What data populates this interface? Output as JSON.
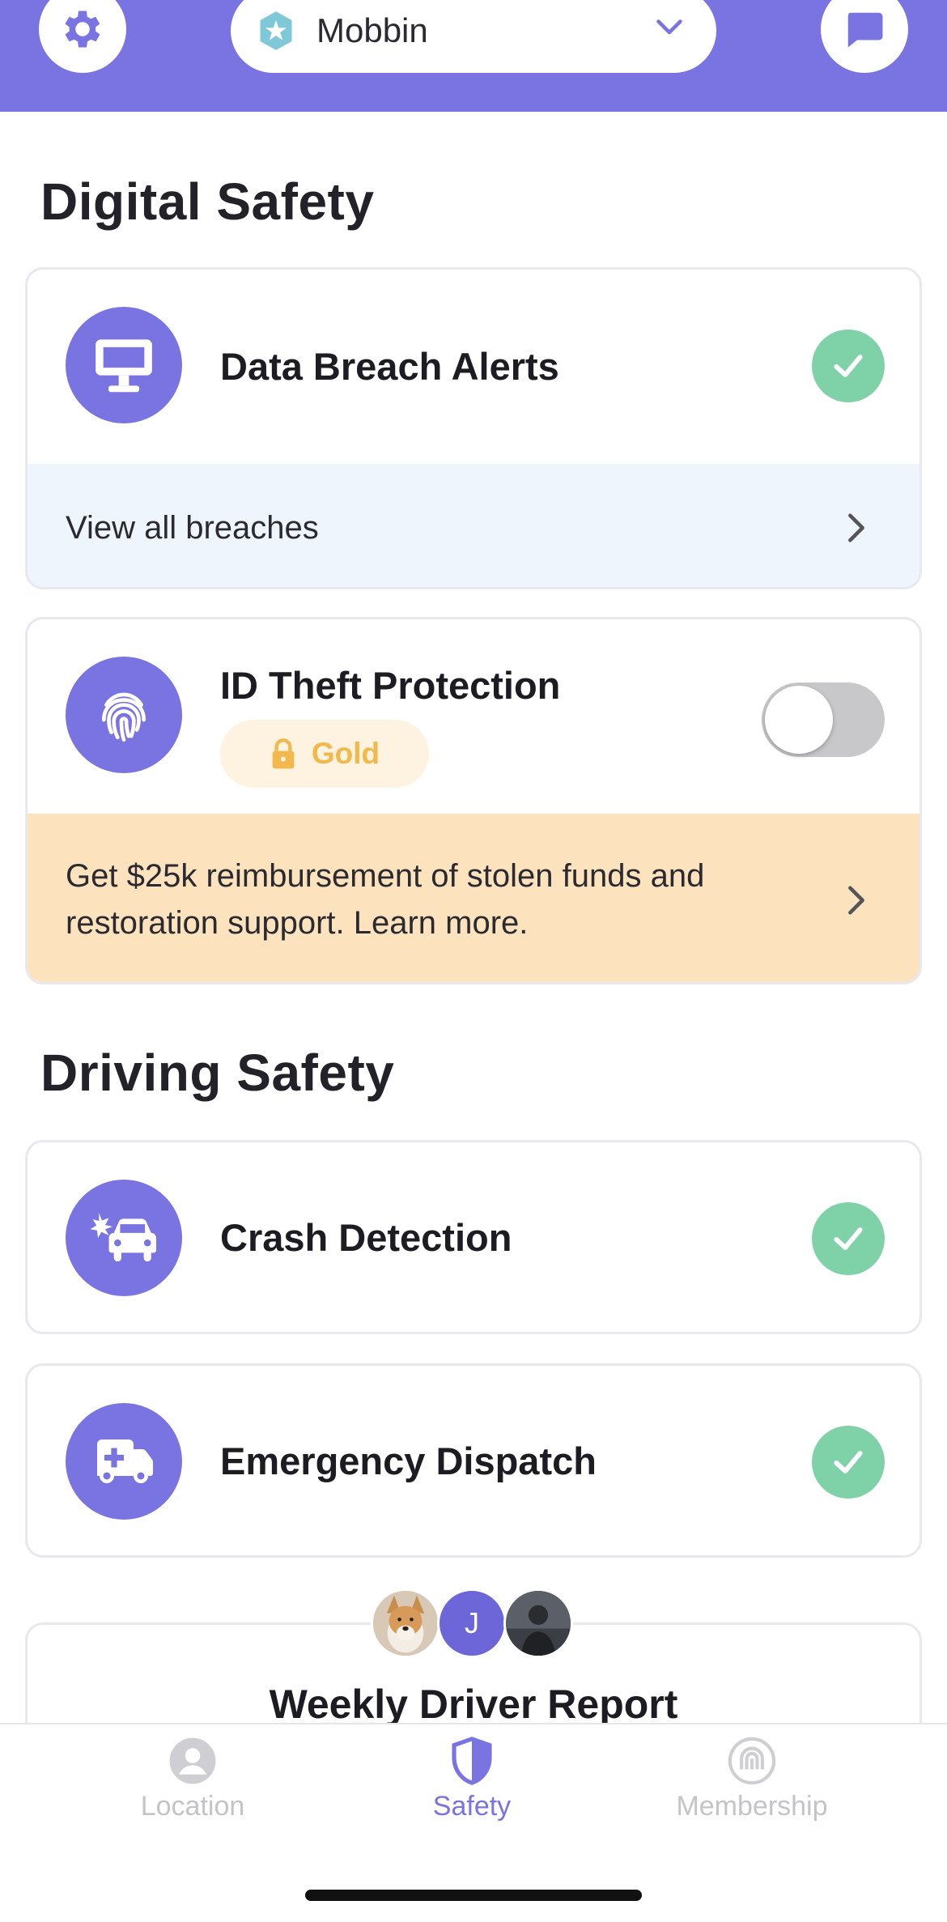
{
  "header": {
    "circle_name": "Mobbin",
    "colors": {
      "brand": "#7a74e2",
      "white": "#ffffff"
    },
    "icons": {
      "left": "gear-icon",
      "right": "chat-icon",
      "circle": "star-badge-icon",
      "dropdown": "chevron-down-icon"
    }
  },
  "digital_safety": {
    "title": "Digital Safety",
    "data_breach": {
      "title": "Data Breach Alerts",
      "link": "View all breaches",
      "enabled": true
    },
    "id_theft": {
      "title": "ID Theft Protection",
      "badge": "Gold",
      "enabled": false,
      "promo_line1": "Get $25k reimbursement of stolen funds and",
      "promo_line2": "restoration support. Learn more."
    }
  },
  "driving_safety": {
    "title": "Driving Safety",
    "crash_detection": {
      "title": "Crash Detection",
      "enabled": true
    },
    "emergency_dispatch": {
      "title": "Emergency Dispatch",
      "enabled": true
    },
    "weekly_report": {
      "title": "Weekly Driver Report",
      "avatar_initial": "J"
    }
  },
  "tabs": [
    {
      "label": "Location",
      "icon": "person-icon",
      "active": false
    },
    {
      "label": "Safety",
      "icon": "shield-icon",
      "active": true
    },
    {
      "label": "Membership",
      "icon": "membership-icon",
      "active": false
    }
  ],
  "colors": {
    "accent": "#7a74e2",
    "success": "#7fd1a8",
    "gold": "#f2b84b",
    "promo_bg": "#fde3bd",
    "link_bg": "#eef5fd"
  }
}
